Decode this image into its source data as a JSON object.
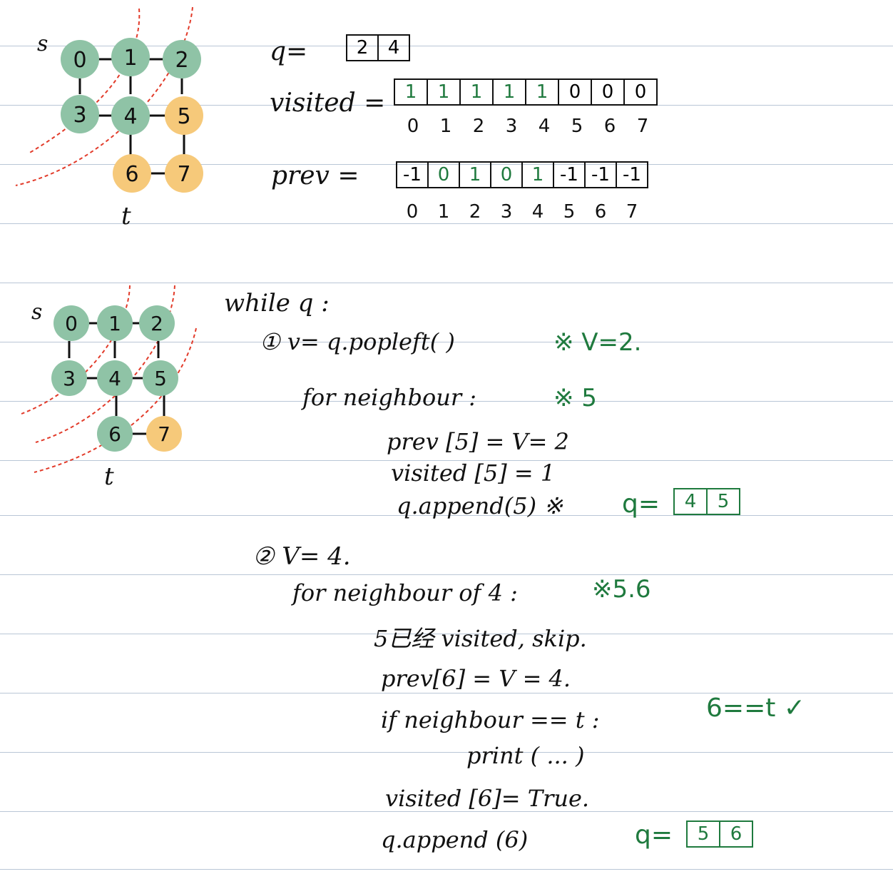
{
  "colors": {
    "visited_node": "#8fc3a6",
    "frontier_node": "#f6c97a",
    "ink": "#111111",
    "green_ink": "#1f7a3e",
    "red_dash": "#e23b2a",
    "rule": "#b9c6d6"
  },
  "graph1": {
    "s_label": "s",
    "t_label": "t",
    "nodes": [
      "0",
      "1",
      "2",
      "3",
      "4",
      "5",
      "6",
      "7"
    ],
    "visited_nodes": [
      "0",
      "1",
      "2",
      "3",
      "4"
    ],
    "frontier_nodes": [
      "5",
      "6",
      "7"
    ]
  },
  "graph2": {
    "s_label": "s",
    "t_label": "t",
    "nodes": [
      "0",
      "1",
      "2",
      "3",
      "4",
      "5",
      "6",
      "7"
    ],
    "visited_nodes": [
      "0",
      "1",
      "2",
      "3",
      "4",
      "5",
      "6"
    ],
    "frontier_nodes": [
      "7"
    ]
  },
  "state": {
    "q_label": "q=",
    "q_values": [
      "2",
      "4"
    ],
    "visited_label": "visited =",
    "visited_values": [
      "1",
      "1",
      "1",
      "1",
      "1",
      "0",
      "0",
      "0"
    ],
    "visited_indices": [
      "0",
      "1",
      "2",
      "3",
      "4",
      "5",
      "6",
      "7"
    ],
    "prev_label": "prev =",
    "prev_values": [
      "-1",
      "0",
      "1",
      "0",
      "1",
      "-1",
      "-1",
      "-1"
    ],
    "prev_indices": [
      "0",
      "1",
      "2",
      "3",
      "4",
      "5",
      "6",
      "7"
    ]
  },
  "code": {
    "while": "while q :",
    "step1_label": "① v= q.popleft( )",
    "step1_note": "※ V=2.",
    "for1": "for neighbour :",
    "for1_note": "※ 5",
    "line_prev5": "prev [5] = V= 2",
    "line_visited5": "visited [5] = 1",
    "line_append5": "q.append(5) ※",
    "q_after1_label": "q=",
    "q_after1": [
      "4",
      "5"
    ],
    "step2_label": "② V= 4.",
    "for2": "for neighbour of 4 :",
    "for2_note": "※5.6",
    "skip_line": "5已经 visited, skip.",
    "line_prev6": "prev[6] = V = 4.",
    "if_line": "if neighbour == t :",
    "if_note": "6==t ✓",
    "print_line": "print ( ... )",
    "visited6_line": "visited [6]= True.",
    "append6_line": "q.append (6)",
    "q_after2_label": "q=",
    "q_after2": [
      "5",
      "6"
    ]
  }
}
